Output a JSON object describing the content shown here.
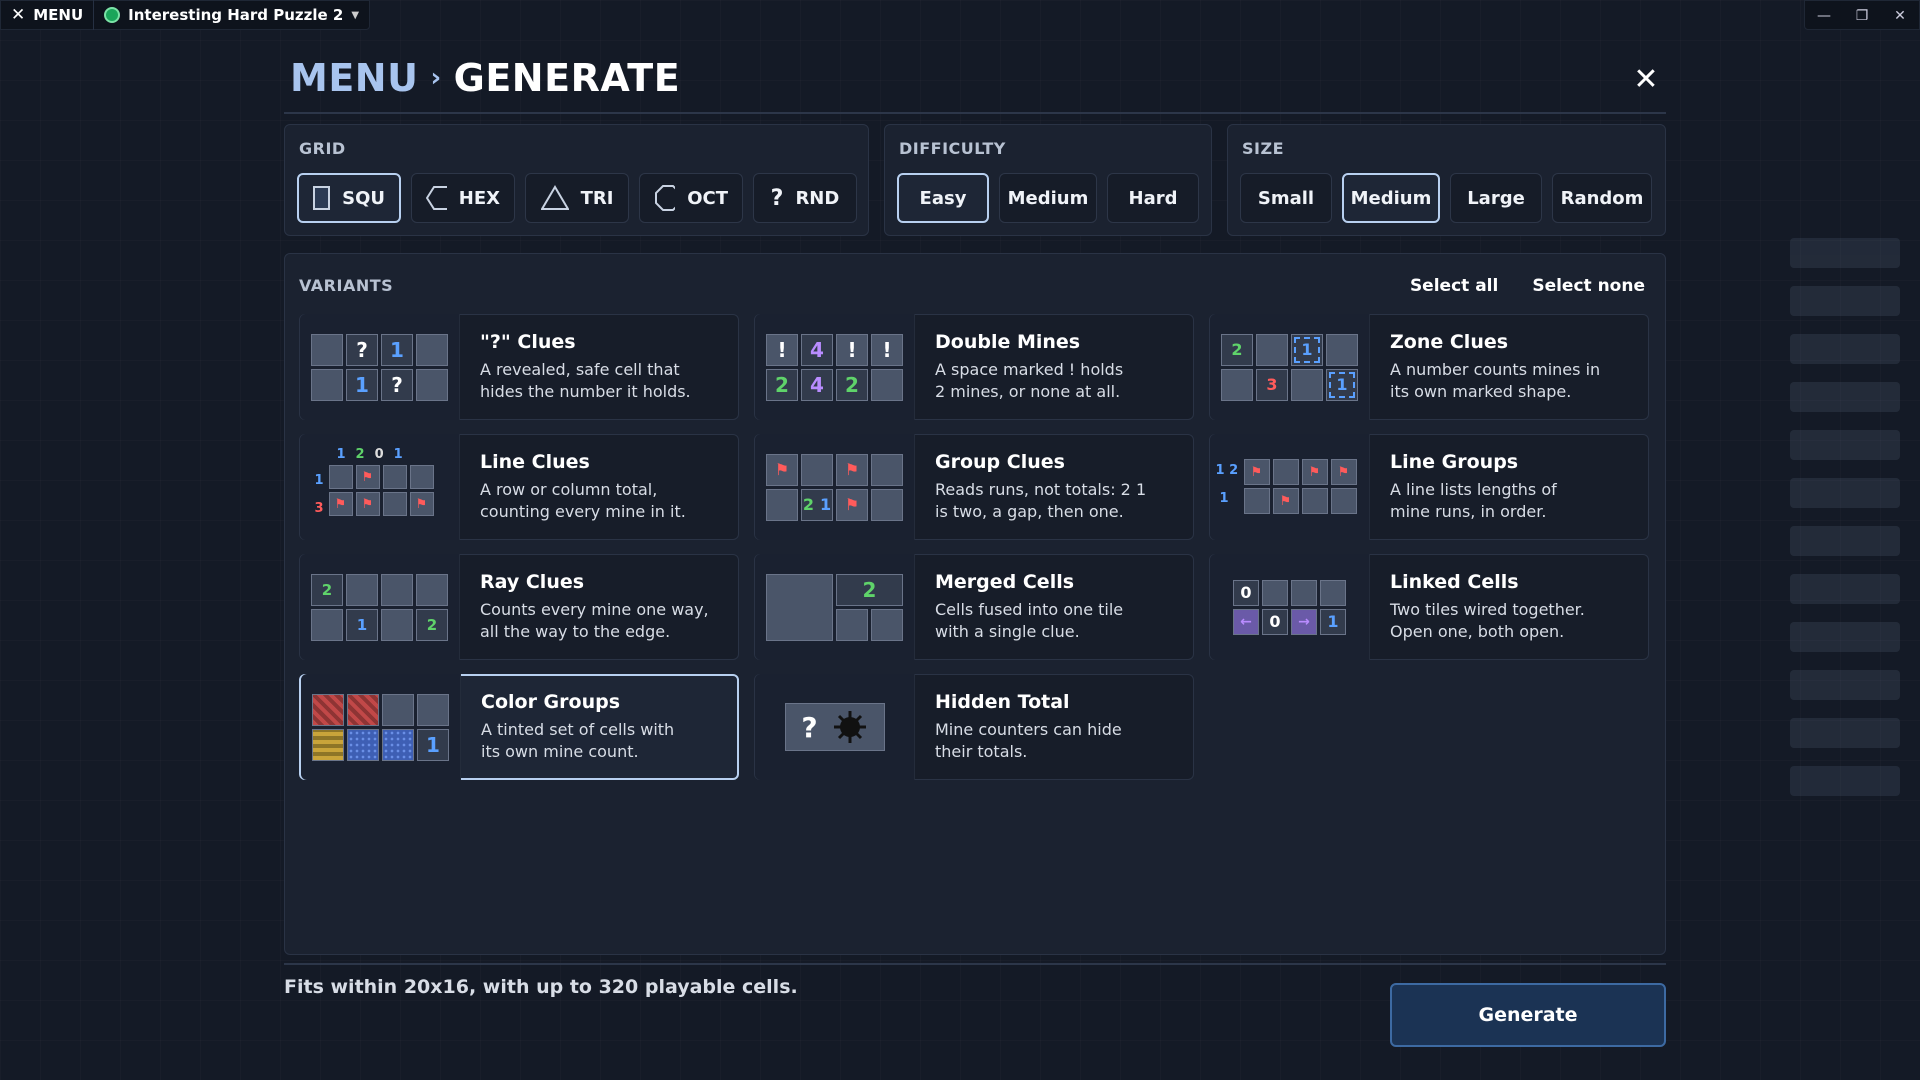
{
  "titlebar": {
    "menu": "MENU",
    "puzzle": "Interesting Hard Puzzle 2"
  },
  "heading": {
    "crumb": "MENU",
    "separator": "›",
    "current": "GENERATE"
  },
  "grid": {
    "label": "GRID",
    "options": [
      {
        "label": "SQU",
        "selected": true
      },
      {
        "label": "HEX",
        "selected": false
      },
      {
        "label": "TRI",
        "selected": false
      },
      {
        "label": "OCT",
        "selected": false
      },
      {
        "label": "RND",
        "selected": false
      }
    ]
  },
  "difficulty": {
    "label": "DIFFICULTY",
    "options": [
      {
        "label": "Easy",
        "selected": true
      },
      {
        "label": "Medium",
        "selected": false
      },
      {
        "label": "Hard",
        "selected": false
      }
    ]
  },
  "size": {
    "label": "SIZE",
    "options": [
      {
        "label": "Small",
        "selected": false
      },
      {
        "label": "Medium",
        "selected": true
      },
      {
        "label": "Large",
        "selected": false
      },
      {
        "label": "Random",
        "selected": false
      }
    ]
  },
  "variants": {
    "label": "VARIANTS",
    "select_all": "Select all",
    "select_none": "Select none",
    "cards": [
      {
        "title": "\"?\" Clues",
        "desc": "A revealed, safe cell that\nhides the number it holds.",
        "selected": false
      },
      {
        "title": "Double Mines",
        "desc": "A space marked ! holds\n2 mines, or none at all.",
        "selected": false
      },
      {
        "title": "Zone Clues",
        "desc": "A number counts mines in\nits own marked shape.",
        "selected": false
      },
      {
        "title": "Line Clues",
        "desc": "A row or column total,\ncounting every mine in it.",
        "selected": false
      },
      {
        "title": "Group Clues",
        "desc": "Reads runs, not totals: 2 1\nis two, a gap, then one.",
        "selected": false
      },
      {
        "title": "Line Groups",
        "desc": "A line lists lengths of\nmine runs, in order.",
        "selected": false
      },
      {
        "title": "Ray Clues",
        "desc": "Counts every mine one way,\nall the way to the edge.",
        "selected": false
      },
      {
        "title": "Merged Cells",
        "desc": "Cells fused into one tile\nwith a single clue.",
        "selected": false
      },
      {
        "title": "Linked Cells",
        "desc": "Two tiles wired together.\nOpen one, both open.",
        "selected": false
      },
      {
        "title": "Color Groups",
        "desc": "A tinted set of cells with\nits own mine count.",
        "selected": true
      },
      {
        "title": "Hidden Total",
        "desc": "Mine counters can hide\ntheir totals.",
        "selected": false
      }
    ]
  },
  "footer": {
    "info": "Fits within 20x16, with up to 320 playable cells.",
    "generate": "Generate"
  },
  "thumbs": {
    "q": [
      "?",
      "1",
      "1",
      "?"
    ],
    "double": [
      "!",
      "4",
      "!",
      "!",
      "2",
      "4",
      "2"
    ],
    "zone": [
      "2",
      "1",
      "3",
      "1"
    ],
    "line": [
      "1",
      "2",
      "0",
      "1",
      "1",
      "3"
    ],
    "group": [
      "2",
      "1"
    ],
    "linegroups": [
      "1 2",
      "1"
    ],
    "ray": [
      "2",
      "1",
      "2"
    ],
    "merged": [
      "2"
    ],
    "linked": [
      "0",
      "0",
      "1"
    ],
    "color": [
      "1"
    ],
    "hidden": [
      "?"
    ]
  },
  "colors": {
    "accent": "#b8d0f0",
    "bg": "#141a26",
    "panel": "#1b2230",
    "generate_bg": "#1b3354"
  }
}
